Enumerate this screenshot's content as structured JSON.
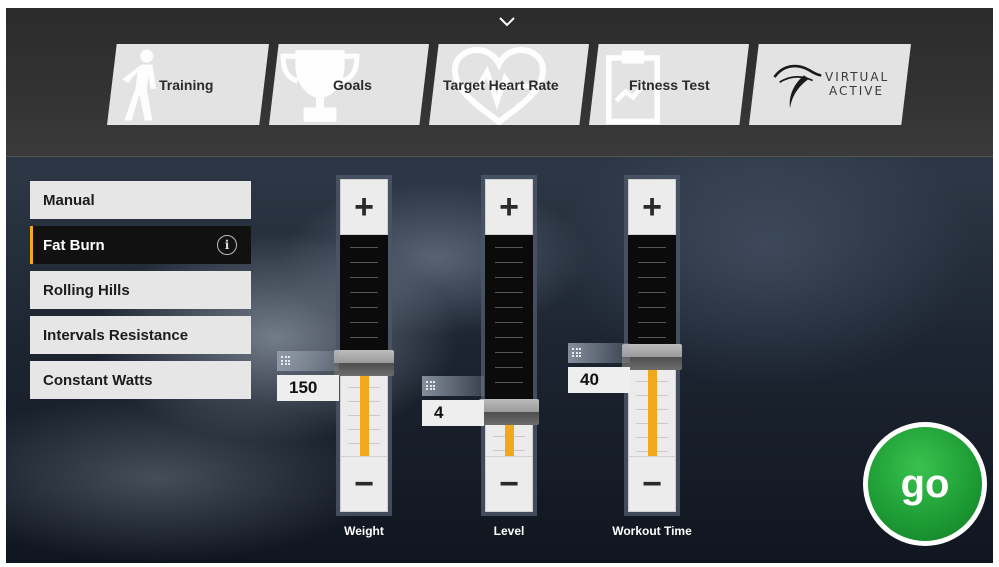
{
  "header": {
    "tabs": [
      {
        "label": "Training",
        "icon": "walking-person-icon"
      },
      {
        "label": "Goals",
        "icon": "trophy-icon"
      },
      {
        "label": "Target Heart Rate",
        "icon": "heart-pulse-icon"
      },
      {
        "label": "Fitness Test",
        "icon": "clipboard-icon"
      },
      {
        "label": "",
        "icon": "virtual-active-logo",
        "logo_line1": "VIRTUAL",
        "logo_line2": "ACTIVE"
      }
    ]
  },
  "programs": [
    {
      "label": "Manual",
      "active": false
    },
    {
      "label": "Fat Burn",
      "active": true
    },
    {
      "label": "Rolling Hills",
      "active": false
    },
    {
      "label": "Intervals Resistance",
      "active": false
    },
    {
      "label": "Constant Watts",
      "active": false
    }
  ],
  "sliders": [
    {
      "label": "Weight",
      "value": "150",
      "plus": "+",
      "minus": "−",
      "level_fraction": 0.42
    },
    {
      "label": "Level",
      "value": "4",
      "plus": "+",
      "minus": "−",
      "level_fraction": 0.2
    },
    {
      "label": "Workout Time",
      "value": "40",
      "plus": "+",
      "minus": "−",
      "level_fraction": 0.45
    }
  ],
  "go_button": {
    "label": "go"
  },
  "colors": {
    "accent": "#f2a81d",
    "go_green": "#1c9a33",
    "active_program_bg": "#111111"
  }
}
